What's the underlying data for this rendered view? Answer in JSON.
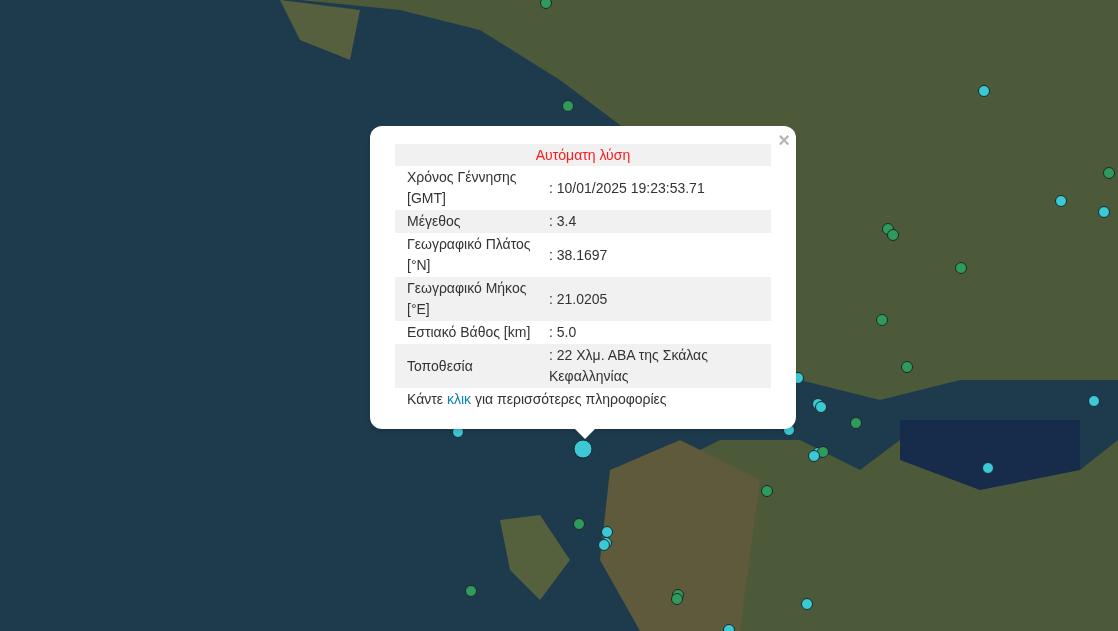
{
  "popup": {
    "close": "×",
    "title": "Αυτόματη λύση",
    "rows": [
      {
        "label": "Χρόνος Γέννησης [GMT]",
        "value": ": 10/01/2025 19:23:53.71"
      },
      {
        "label": "Μέγεθος",
        "value": ": 3.4"
      },
      {
        "label": "Γεωγραφικό Πλάτος [°N]",
        "value": ": 38.1697"
      },
      {
        "label": "Γεωγραφικό Μήκος [°E]",
        "value": ": 21.0205"
      },
      {
        "label": "Εστιακό Βάθος [km]",
        "value": ": 5.0"
      },
      {
        "label": "Τοποθεσία",
        "value": ": 22 Χλμ. ΑΒΑ της Σκάλας Κεφαλληνίας"
      }
    ],
    "footer": {
      "before": "Κάντε ",
      "link": "κλικ",
      "after": " για περισσότερες πληροφορίες"
    }
  }
}
